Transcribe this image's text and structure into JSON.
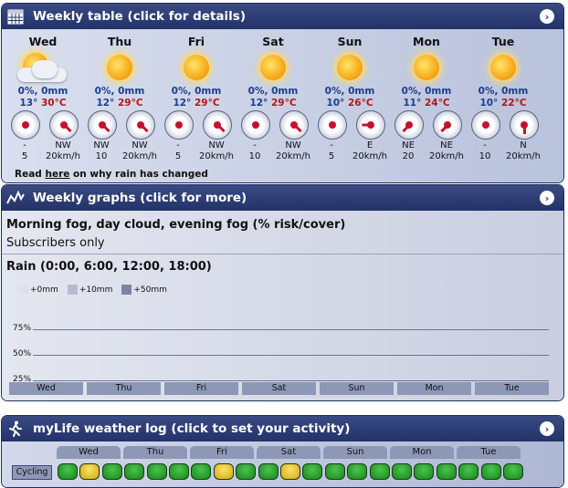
{
  "weekly_table": {
    "title": "Weekly table (click for details)",
    "days": [
      {
        "name": "Wed",
        "icon": "partly-cloudy-icon",
        "rain": "0%, 0mm",
        "lo": "13°",
        "hi": "30°C",
        "winds": [
          {
            "dir": "-",
            "speed": "5",
            "deg": 0,
            "calm": true
          },
          {
            "dir": "NW",
            "speed": "20km/h",
            "deg": 135,
            "calm": false
          }
        ]
      },
      {
        "name": "Thu",
        "icon": "sun-icon",
        "rain": "0%, 0mm",
        "lo": "12°",
        "hi": "29°C",
        "winds": [
          {
            "dir": "NW",
            "speed": "10",
            "deg": 135,
            "calm": false
          },
          {
            "dir": "NW",
            "speed": "20km/h",
            "deg": 135,
            "calm": false
          }
        ]
      },
      {
        "name": "Fri",
        "icon": "sun-icon",
        "rain": "0%, 0mm",
        "lo": "12°",
        "hi": "29°C",
        "winds": [
          {
            "dir": "-",
            "speed": "5",
            "deg": 0,
            "calm": true
          },
          {
            "dir": "NW",
            "speed": "20km/h",
            "deg": 135,
            "calm": false
          }
        ]
      },
      {
        "name": "Sat",
        "icon": "sun-icon",
        "rain": "0%, 0mm",
        "lo": "12°",
        "hi": "29°C",
        "winds": [
          {
            "dir": "-",
            "speed": "10",
            "deg": 0,
            "calm": true
          },
          {
            "dir": "NW",
            "speed": "20km/h",
            "deg": 135,
            "calm": false
          }
        ]
      },
      {
        "name": "Sun",
        "icon": "sun-icon",
        "rain": "0%, 0mm",
        "lo": "10°",
        "hi": "26°C",
        "winds": [
          {
            "dir": "-",
            "speed": "5",
            "deg": 0,
            "calm": true
          },
          {
            "dir": "E",
            "speed": "20km/h",
            "deg": 270,
            "calm": false
          }
        ]
      },
      {
        "name": "Mon",
        "icon": "sun-icon",
        "rain": "0%, 0mm",
        "lo": "11°",
        "hi": "24°C",
        "winds": [
          {
            "dir": "NE",
            "speed": "20",
            "deg": 225,
            "calm": false
          },
          {
            "dir": "NE",
            "speed": "20km/h",
            "deg": 225,
            "calm": false
          }
        ]
      },
      {
        "name": "Tue",
        "icon": "sun-icon",
        "rain": "0%, 0mm",
        "lo": "10°",
        "hi": "22°C",
        "winds": [
          {
            "dir": "-",
            "speed": "10",
            "deg": 0,
            "calm": true
          },
          {
            "dir": "N",
            "speed": "20km/h",
            "deg": 180,
            "calm": false
          }
        ]
      }
    ],
    "note_prefix": "Read ",
    "note_link": "here",
    "note_suffix": " on why rain has changed"
  },
  "weekly_graphs": {
    "title": "Weekly graphs (click for more)",
    "fog_title": "Morning fog, day cloud, evening fog (% risk/cover)",
    "subscribers": "Subscribers only",
    "rain_title": "Rain (0:00, 6:00, 12:00, 18:00)",
    "legend": [
      {
        "label": "+0mm",
        "color": "#dde1ee"
      },
      {
        "label": "+10mm",
        "color": "#b6bcd0"
      },
      {
        "label": "+50mm",
        "color": "#7a84a6"
      }
    ],
    "y_ticks": [
      "75%",
      "50%",
      "25%"
    ],
    "days": [
      "Wed",
      "Thu",
      "Fri",
      "Sat",
      "Sun",
      "Mon",
      "Tue"
    ]
  },
  "mylife": {
    "title": "myLife weather log (click to set your activity)",
    "days": [
      "Wed",
      "Thu",
      "Fri",
      "Sat",
      "Sun",
      "Mon",
      "Tue"
    ],
    "activity": "Cycling",
    "ratings": [
      "good",
      "fair",
      "good",
      "good",
      "good",
      "good",
      "good",
      "fair",
      "good",
      "good",
      "fair",
      "good",
      "good",
      "good",
      "good",
      "good",
      "good",
      "good",
      "good",
      "good",
      "good"
    ],
    "colors": {
      "good": "#1e9a22",
      "fair": "#e7c12a"
    }
  }
}
